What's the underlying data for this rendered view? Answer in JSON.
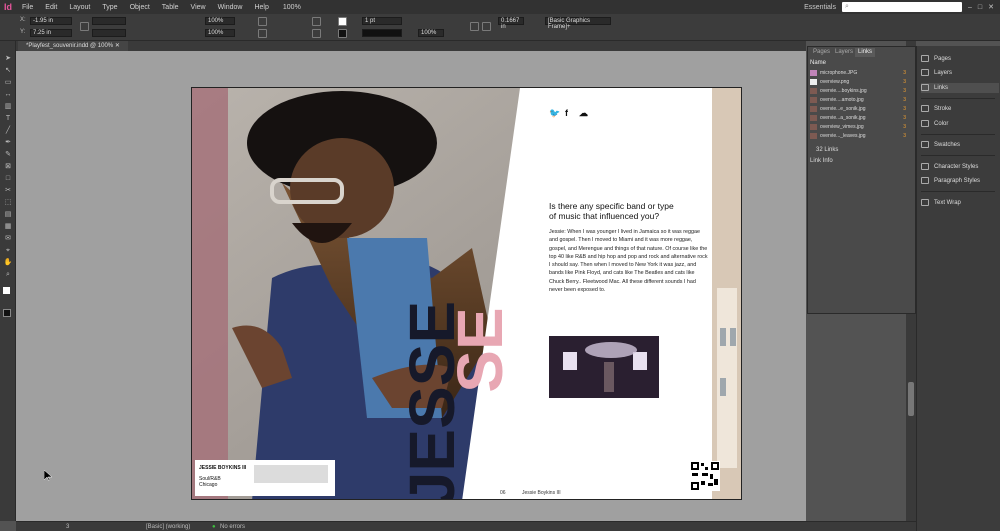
{
  "app": {
    "logo": "Id",
    "zoom": "100%",
    "workspace": "Essentials"
  },
  "menu": [
    "File",
    "Edit",
    "Layout",
    "Type",
    "Object",
    "Table",
    "View",
    "Window",
    "Help"
  ],
  "control_panel": {
    "x": "-1.95 in",
    "y": "7.25 in",
    "stroke_weight": "1 pt",
    "tint": "100%",
    "offset": "0.1667 in",
    "object_style": "[Basic Graphics Frame]+",
    "pct1": "100%",
    "pct2": "100%"
  },
  "document_tab": {
    "title": "*Playfest_souvenir.indd @ 100%"
  },
  "spread": {
    "social_icons": [
      "twitter-icon",
      "facebook-icon",
      "soundcloud-icon"
    ],
    "social_glyphs": [
      "🐦",
      "f",
      "☁"
    ],
    "question": "Is there any specific band or type of music that influenced you?",
    "answer": "Jessie: When I was younger I lived in Jamaica so it was reggae and gospel. Then I moved to Miami and it was more reggae, gospel, and Merengue and things of that nature. Of course like the top 40 like R&B and hip hop and pop and rock and alternative rock I should say. Then when I moved to New York it was jazz, and bands like Pink Floyd, and cats like The Beatles and cats like Chuck Berry.. Fleetwood Mac. All these different sounds I had never been exposed to.",
    "big_word_black": "JESSE",
    "big_word_pink": "SE",
    "caption": {
      "name": "JESSIE BOYKINS III",
      "genre": "Soul/R&B",
      "city": "Chicago"
    },
    "folio": "06",
    "folio_name": "Jessie Boykins III",
    "accent_pink": "#e8a7b3"
  },
  "links_panel": {
    "tabs": [
      "Pages",
      "Layers",
      "Links"
    ],
    "header": "Name",
    "rows": [
      {
        "name": "microphone.JPG",
        "page": "3"
      },
      {
        "name": "overview.png",
        "page": "3"
      },
      {
        "name": "overvie....boykins.jpg",
        "page": "3"
      },
      {
        "name": "overvie....amoto.jpg",
        "page": "3"
      },
      {
        "name": "overvie...e_sonik.jpg",
        "page": "3"
      },
      {
        "name": "overvie...a_sonik.jpg",
        "page": "3"
      },
      {
        "name": "overview_vimes.jpg",
        "page": "3"
      },
      {
        "name": "overvie..._leaves.jpg",
        "page": "3"
      }
    ],
    "count": "32 Links",
    "link_info": "Link Info"
  },
  "dock": [
    {
      "label": "Pages",
      "icon": "pages-icon"
    },
    {
      "label": "Layers",
      "icon": "layers-icon"
    },
    {
      "label": "Links",
      "icon": "links-icon",
      "active": true
    },
    {
      "label": "Stroke",
      "icon": "stroke-icon"
    },
    {
      "label": "Color",
      "icon": "color-icon"
    },
    {
      "label": "Swatches",
      "icon": "swatches-icon"
    },
    {
      "label": "Character Styles",
      "icon": "character-styles-icon"
    },
    {
      "label": "Paragraph Styles",
      "icon": "paragraph-styles-icon"
    },
    {
      "label": "Text Wrap",
      "icon": "text-wrap-icon"
    }
  ],
  "status": {
    "page": "3",
    "profile": "[Basic] (working)",
    "errors": "No errors"
  }
}
